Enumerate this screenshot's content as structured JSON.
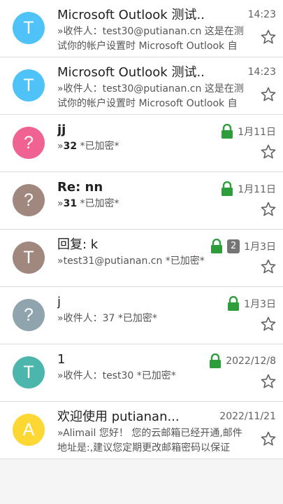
{
  "colors": {
    "blue": "#4fc3f7",
    "pink": "#f06292",
    "brown": "#a1887f",
    "grey": "#90a4ae",
    "teal": "#4db6ac",
    "yellow": "#fdd835",
    "lock_green": "#2e9e3c"
  },
  "icons": {
    "lock": "lock-icon",
    "star": "star-outline-icon"
  },
  "emails": [
    {
      "avatar": "T",
      "avatar_color": "#4fc3f7",
      "subject": "Microsoft Outlook 测试..",
      "bold": false,
      "prefix": "»",
      "sender": "",
      "preview": "收件人：test30@putianan.cn 这是在测试你的帐户设置时 Microsoft Outlook 自",
      "time": "14:23",
      "locked": false,
      "count": ""
    },
    {
      "avatar": "T",
      "avatar_color": "#4fc3f7",
      "subject": "Microsoft Outlook 测试..",
      "bold": false,
      "prefix": "»",
      "sender": "",
      "preview": "收件人：test30@putianan.cn 这是在测试你的帐户设置时 Microsoft Outlook 自",
      "time": "14:23",
      "locked": false,
      "count": ""
    },
    {
      "avatar": "?",
      "avatar_color": "#f06292",
      "subject": "jj",
      "bold": true,
      "prefix": "»",
      "sender": "32",
      "preview": " *已加密*",
      "time": "1月11日",
      "locked": true,
      "count": ""
    },
    {
      "avatar": "?",
      "avatar_color": "#a1887f",
      "subject": "Re: nn",
      "bold": true,
      "prefix": "»",
      "sender": "31",
      "preview": " *已加密*",
      "time": "1月11日",
      "locked": true,
      "count": ""
    },
    {
      "avatar": "T",
      "avatar_color": "#a1887f",
      "subject": "回复: k",
      "bold": false,
      "prefix": "»",
      "sender": "",
      "preview": "test31@putianan.cn *已加密*",
      "time": "1月3日",
      "locked": true,
      "count": "2"
    },
    {
      "avatar": "?",
      "avatar_color": "#90a4ae",
      "subject": "j",
      "bold": false,
      "prefix": "»",
      "sender": "",
      "preview": "收件人：37 *已加密*",
      "time": "1月3日",
      "locked": true,
      "count": ""
    },
    {
      "avatar": "T",
      "avatar_color": "#4db6ac",
      "subject": "1",
      "bold": false,
      "prefix": "»",
      "sender": "",
      "preview": "收件人：test30 *已加密*",
      "time": "2022/12/8",
      "locked": true,
      "count": ""
    },
    {
      "avatar": "A",
      "avatar_color": "#fdd835",
      "subject": "欢迎使用 putianan...",
      "bold": false,
      "prefix": "»",
      "sender": "",
      "preview": "Alimail 您好！ 您的云邮箱已经开通,邮件地址是:,建议您定期更改邮箱密码以保证",
      "time": "2022/11/21",
      "locked": false,
      "count": ""
    }
  ]
}
